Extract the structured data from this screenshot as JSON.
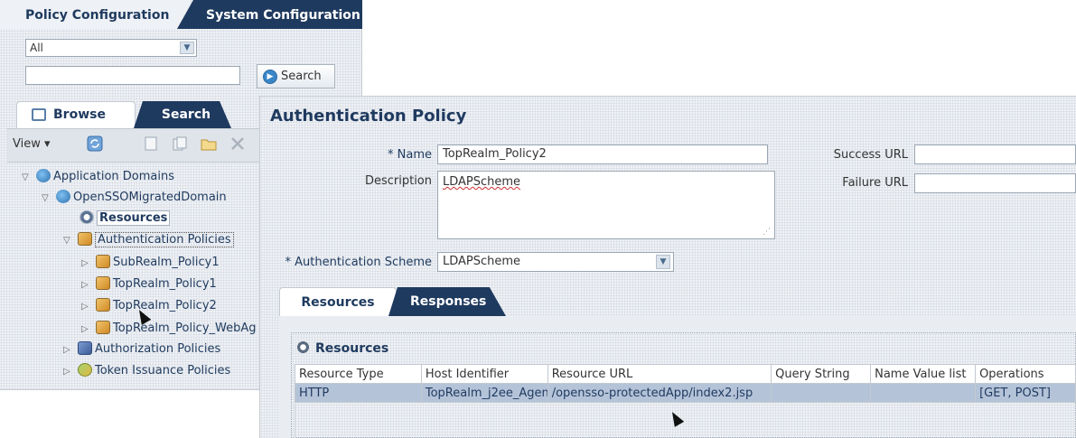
{
  "top_tabs": {
    "policy_configuration": "Policy Configuration",
    "system_configuration": "System Configuration"
  },
  "search_panel": {
    "scope_value": "All",
    "search_text": "",
    "search_button": "Search"
  },
  "browse_tabs": {
    "browse": "Browse",
    "search": "Search"
  },
  "toolbar": {
    "view_menu": "View ▾"
  },
  "tree": {
    "application_domains": "Application Domains",
    "domain": "OpenSSOMigratedDomain",
    "resources": "Resources",
    "authentication_policies": "Authentication Policies",
    "policies": [
      "SubRealm_Policy1",
      "TopRealm_Policy1",
      "TopRealm_Policy2",
      "TopRealm_Policy_WebAg"
    ],
    "authorization_policies": "Authorization Policies",
    "token_issuance_policies": "Token Issuance Policies"
  },
  "form": {
    "title": "Authentication Policy",
    "name_label": "* Name",
    "name_value": "TopRealm_Policy2",
    "description_label": "Description",
    "description_value": "LDAPScheme",
    "success_url_label": "Success URL",
    "success_url_value": "",
    "failure_url_label": "Failure URL",
    "failure_url_value": "",
    "scheme_label": "* Authentication Scheme",
    "scheme_value": "LDAPScheme"
  },
  "detail_tabs": {
    "resources": "Resources",
    "responses": "Responses"
  },
  "resources_section": {
    "heading": "Resources",
    "columns": [
      "Resource Type",
      "Host Identifier",
      "Resource URL",
      "Query String",
      "Name Value list",
      "Operations"
    ],
    "rows": [
      [
        "HTTP",
        "TopRealm_j2ee_Agen",
        "/opensso-protectedApp/index2.jsp",
        "",
        "",
        "[GET, POST]"
      ]
    ]
  }
}
